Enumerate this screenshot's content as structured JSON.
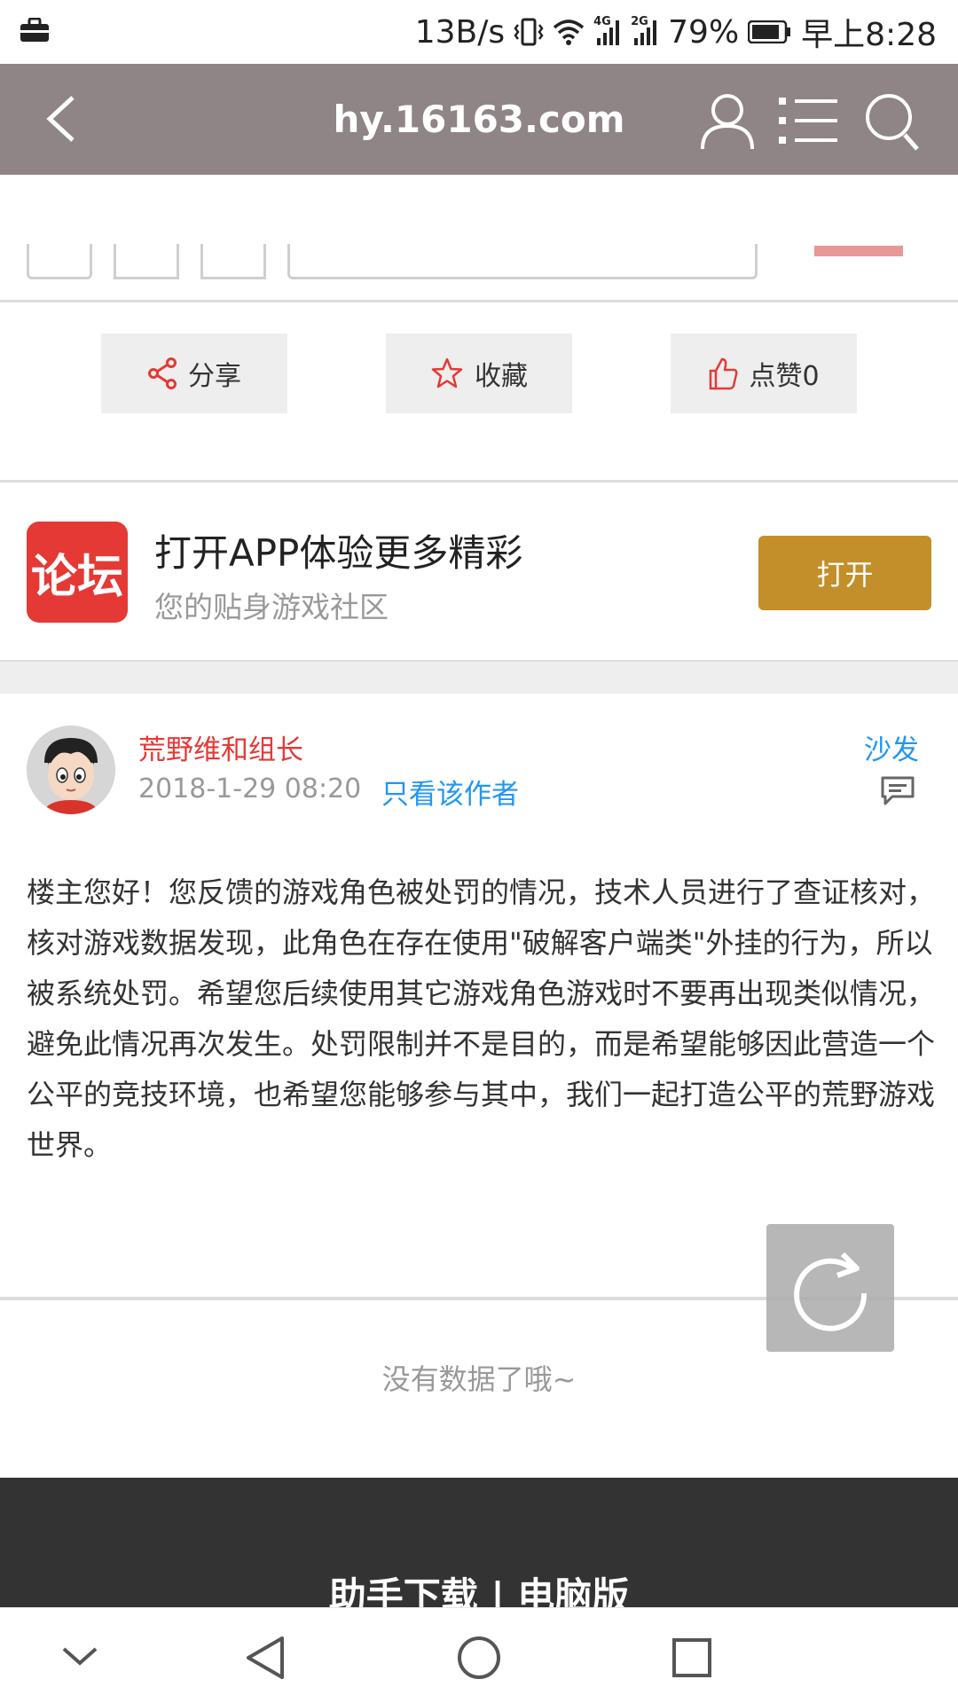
{
  "status_bar": {
    "speed": "13B/s",
    "network_4g": "4G",
    "network_2g": "2G",
    "battery": "79%",
    "time": "早上8:28"
  },
  "browser": {
    "url": "hy.16163.com"
  },
  "actions": {
    "share": "分享",
    "favorite": "收藏",
    "like": "点赞0"
  },
  "promo": {
    "logo_text": "论坛",
    "title": "打开APP体验更多精彩",
    "subtitle": "您的贴身游戏社区",
    "open": "打开"
  },
  "post": {
    "author": "荒野维和组长",
    "date": "2018-1-29 08:20",
    "only_author": "只看该作者",
    "floor": "沙发",
    "body": "楼主您好！您反馈的游戏角色被处罚的情况，技术人员进行了查证核对，核对游戏数据发现，此角色在存在使用\"破解客户端类\"外挂的行为，所以被系统处罚。希望您后续使用其它游戏角色游戏时不要再出现类似情况，避免此情况再次发生。处罚限制并不是目的，而是希望能够因此营造一个公平的竞技环境，也希望您能够参与其中，我们一起打造公平的荒野游戏世界。"
  },
  "no_data": "没有数据了哦~",
  "footer": {
    "links": "助手下载 | 电脑版"
  },
  "colors": {
    "header_bg": "#8f8486",
    "accent_red": "#e53935",
    "link_blue": "#2196f3",
    "open_button": "#c28f2a"
  }
}
